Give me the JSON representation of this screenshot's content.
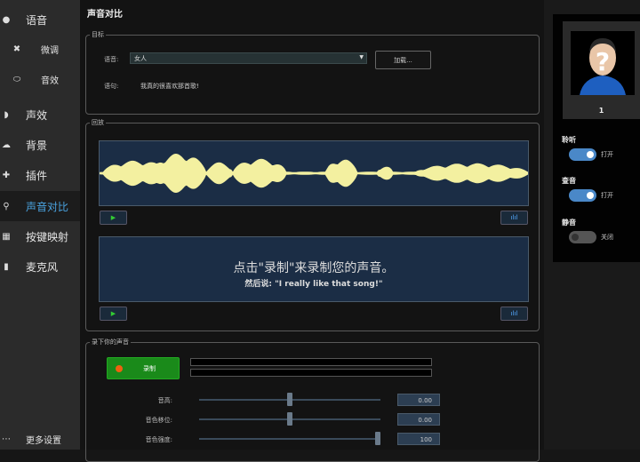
{
  "sidebar": {
    "items": [
      {
        "label": "语音",
        "icon": "voice-icon"
      },
      {
        "label": "微调",
        "icon": "tools-icon"
      },
      {
        "label": "音效",
        "icon": "lips-icon"
      },
      {
        "label": "声效",
        "icon": "sound-icon"
      },
      {
        "label": "背景",
        "icon": "cloud-icon"
      },
      {
        "label": "插件",
        "icon": "plugin-icon"
      },
      {
        "label": "声音对比",
        "icon": "search-icon"
      },
      {
        "label": "按键映射",
        "icon": "keyboard-icon"
      },
      {
        "label": "麦克风",
        "icon": "microphone-icon"
      }
    ],
    "more_settings": "更多设置"
  },
  "main": {
    "title": "声音对比",
    "target": {
      "legend": "目标",
      "voice_label": "语音:",
      "voice_value": "女人",
      "load_button": "加载...",
      "sentence_label": "语句:",
      "sentence": "我真的很喜欢那首歌!"
    },
    "playback": {
      "legend": "回放",
      "prompt_line1": "点击\"录制\"来录制您的声音。",
      "prompt_line2": "然后说: \"I really like that song!\""
    },
    "record": {
      "legend": "录下你的声音",
      "record_button": "录制",
      "sliders": [
        {
          "label": "音高:",
          "value": "0.00",
          "fraction": 0.5
        },
        {
          "label": "音色移位:",
          "value": "0.00",
          "fraction": 0.5
        },
        {
          "label": "音色强度:",
          "value": "100",
          "fraction": 1.0
        }
      ]
    }
  },
  "right": {
    "user_number": "1",
    "toggles": [
      {
        "title": "聆听",
        "state": "打开",
        "on": true
      },
      {
        "title": "查音",
        "state": "打开",
        "on": true
      },
      {
        "title": "静音",
        "state": "关闭",
        "on": false
      }
    ]
  },
  "colors": {
    "accent": "#4aa3e0",
    "waveform": "#f3f0a0",
    "record_green": "#1a8a1a",
    "toggle_on": "#4a88c8"
  }
}
